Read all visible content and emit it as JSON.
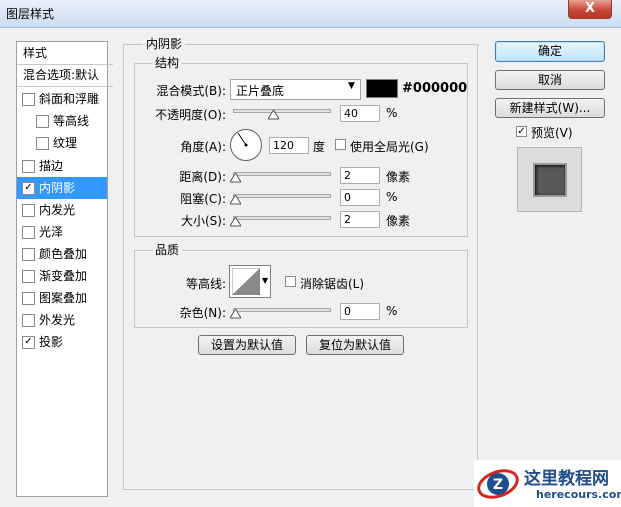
{
  "window": {
    "title": "图层样式",
    "close_label": "X"
  },
  "sidebar": {
    "header": "样式",
    "blend_options": "混合选项:默认",
    "items": [
      {
        "label": "斜面和浮雕",
        "checked": false
      },
      {
        "label": "等高线",
        "checked": false
      },
      {
        "label": "纹理",
        "checked": false
      },
      {
        "label": "描边",
        "checked": false
      },
      {
        "label": "内阴影",
        "checked": true
      },
      {
        "label": "内发光",
        "checked": false
      },
      {
        "label": "光泽",
        "checked": false
      },
      {
        "label": "颜色叠加",
        "checked": false
      },
      {
        "label": "渐变叠加",
        "checked": false
      },
      {
        "label": "图案叠加",
        "checked": false
      },
      {
        "label": "外发光",
        "checked": false
      },
      {
        "label": "投影",
        "checked": true
      }
    ]
  },
  "inner_shadow": {
    "title": "内阴影",
    "structure": {
      "title": "结构",
      "blend_mode_label": "混合模式(B):",
      "blend_mode_value": "正片叠底",
      "color_hex": "#000000",
      "opacity_label": "不透明度(O):",
      "opacity_value": "40",
      "opacity_unit": "%",
      "opacity_level": 0.4,
      "angle_label": "角度(A):",
      "angle_value": "120",
      "angle_unit": "度",
      "global_light_label": "使用全局光(G)",
      "global_light_checked": false,
      "distance_label": "距离(D):",
      "distance_value": "2",
      "distance_unit": "像素",
      "choke_label": "阻塞(C):",
      "choke_value": "0",
      "choke_unit": "%",
      "size_label": "大小(S):",
      "size_value": "2",
      "size_unit": "像素"
    },
    "quality": {
      "title": "品质",
      "contour_label": "等高线:",
      "anti_alias_label": "消除锯齿(L)",
      "anti_alias_checked": false,
      "noise_label": "杂色(N):",
      "noise_value": "0",
      "noise_unit": "%"
    },
    "buttons": {
      "make_default": "设置为默认值",
      "reset_default": "复位为默认值"
    }
  },
  "right": {
    "ok": "确定",
    "cancel": "取消",
    "new_style": "新建样式(W)...",
    "preview_label": "预览(V)",
    "preview_checked": true
  },
  "watermark": {
    "name": "这里教程网",
    "url": "herecours.com"
  },
  "colors": {
    "selection": "#3399ff",
    "swatch": "#000000"
  }
}
